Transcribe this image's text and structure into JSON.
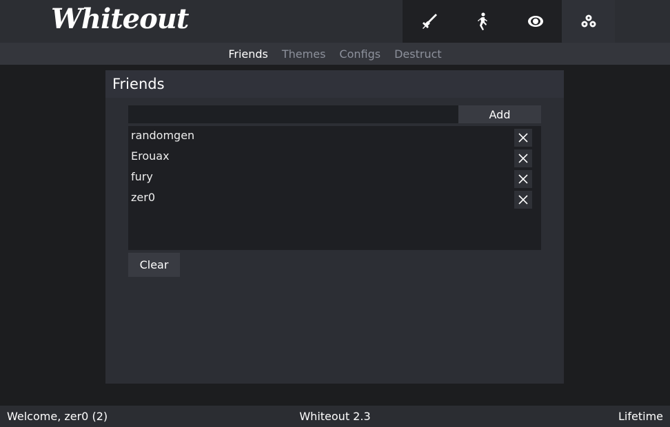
{
  "app": {
    "logo_text": "Whiteout"
  },
  "category_tabs": [
    {
      "name": "combat",
      "icon": "sword-icon",
      "active": false
    },
    {
      "name": "movement",
      "icon": "walking-person-icon",
      "active": false
    },
    {
      "name": "visuals",
      "icon": "eye-icon",
      "active": false
    },
    {
      "name": "misc",
      "icon": "cogs-icon",
      "active": true
    }
  ],
  "subnav": {
    "items": [
      "Friends",
      "Themes",
      "Configs",
      "Destruct"
    ],
    "active": "Friends"
  },
  "panel": {
    "title": "Friends",
    "add_input_value": "",
    "add_label": "Add",
    "friends": [
      "randomgen",
      "Erouax",
      "fury",
      "zer0"
    ],
    "clear_label": "Clear"
  },
  "status": {
    "left": "Welcome, zer0 (2)",
    "center": "Whiteout 2.3",
    "right": "Lifetime"
  },
  "colors": {
    "background": "#1c1d1f",
    "topbar": "#2c2e33",
    "panel": "#2c2e34",
    "active_text": "#ffffff",
    "inactive_text": "#8d919c"
  }
}
